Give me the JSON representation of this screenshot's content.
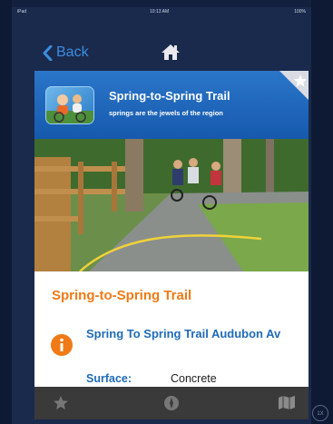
{
  "status_bar": {
    "carrier": "iPad",
    "time": "10:13 AM",
    "battery": "100%"
  },
  "nav": {
    "back_label": "Back"
  },
  "trail": {
    "header_title": "Spring-to-Spring Trail",
    "header_subtitle": "springs are the jewels of the region",
    "name": "Spring-to-Spring Trail",
    "address": "Spring To Spring Trail Audubon Av",
    "surface_label": "Surface:",
    "surface_value": "Concrete"
  },
  "side_badge": "1X",
  "colors": {
    "header_blue": "#1f6bb8",
    "title_orange": "#f07a16",
    "link_blue": "#3b8ee0"
  },
  "icons": [
    "back-chevron-icon",
    "home-icon",
    "star-icon",
    "info-icon",
    "compass-icon",
    "map-icon"
  ]
}
